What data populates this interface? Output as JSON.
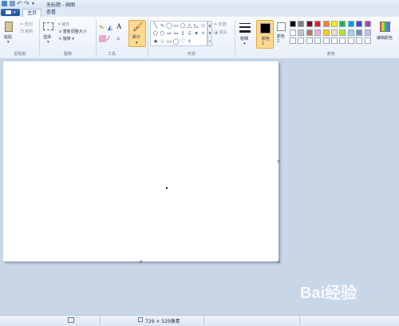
{
  "window": {
    "title": "无标题 - 画图"
  },
  "tabs": {
    "file_label": "",
    "home": "主页",
    "view": "查看"
  },
  "clipboard": {
    "paste": "粘贴",
    "cut": "剪切",
    "copy": "复制",
    "group": "剪贴板"
  },
  "image": {
    "select": "选择",
    "crop": "裁剪",
    "resize": "重新调整大小",
    "rotate": "旋转",
    "group": "图像"
  },
  "tools": {
    "group": "工具"
  },
  "brushes": {
    "label": "刷子"
  },
  "shapes": {
    "group": "形状",
    "outline": "轮廓",
    "fill": "填充"
  },
  "size": {
    "label": "粗细"
  },
  "colors": {
    "color1": "颜色 1",
    "color1_num": "",
    "color2": "颜色 2",
    "edit": "编辑颜色",
    "group": "颜色",
    "palette_row1": [
      "#000000",
      "#7f7f7f",
      "#880015",
      "#ed1c24",
      "#ff7f27",
      "#fff200",
      "#22b14c",
      "#00a2e8",
      "#3f48cc",
      "#a349a4"
    ],
    "palette_row2": [
      "#ffffff",
      "#c3c3c3",
      "#b97a57",
      "#ffaec9",
      "#ffc90e",
      "#efe4b0",
      "#b5e61d",
      "#99d9ea",
      "#7092be",
      "#c8bfe7"
    ]
  },
  "status": {
    "dimensions": "729 × 529像素"
  },
  "watermark": "Bai经验"
}
